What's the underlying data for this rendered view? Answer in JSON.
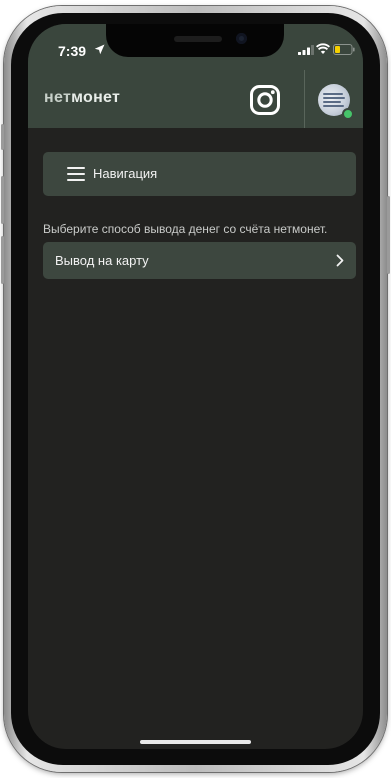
{
  "status_bar": {
    "time": "7:39",
    "icons": [
      "location-arrow-icon",
      "signal-icon",
      "wifi-icon",
      "battery-low-icon"
    ],
    "battery_color": "#f5d000"
  },
  "header": {
    "logo_part1": "нет",
    "logo_part2": "монет",
    "icons": [
      "instagram-icon"
    ],
    "avatar_status_color": "#46c46a"
  },
  "navigation": {
    "label": "Навигация",
    "icon": "hamburger-menu-icon"
  },
  "main": {
    "helper_text": "Выберите способ вывода денег со счёта нетмонет.",
    "options": [
      {
        "label": "Вывод на карту",
        "icon": "chevron-right-icon"
      }
    ]
  },
  "theme": {
    "header_bg": "#3a463d",
    "page_bg": "#222220",
    "card_bg": "#3d473f"
  }
}
